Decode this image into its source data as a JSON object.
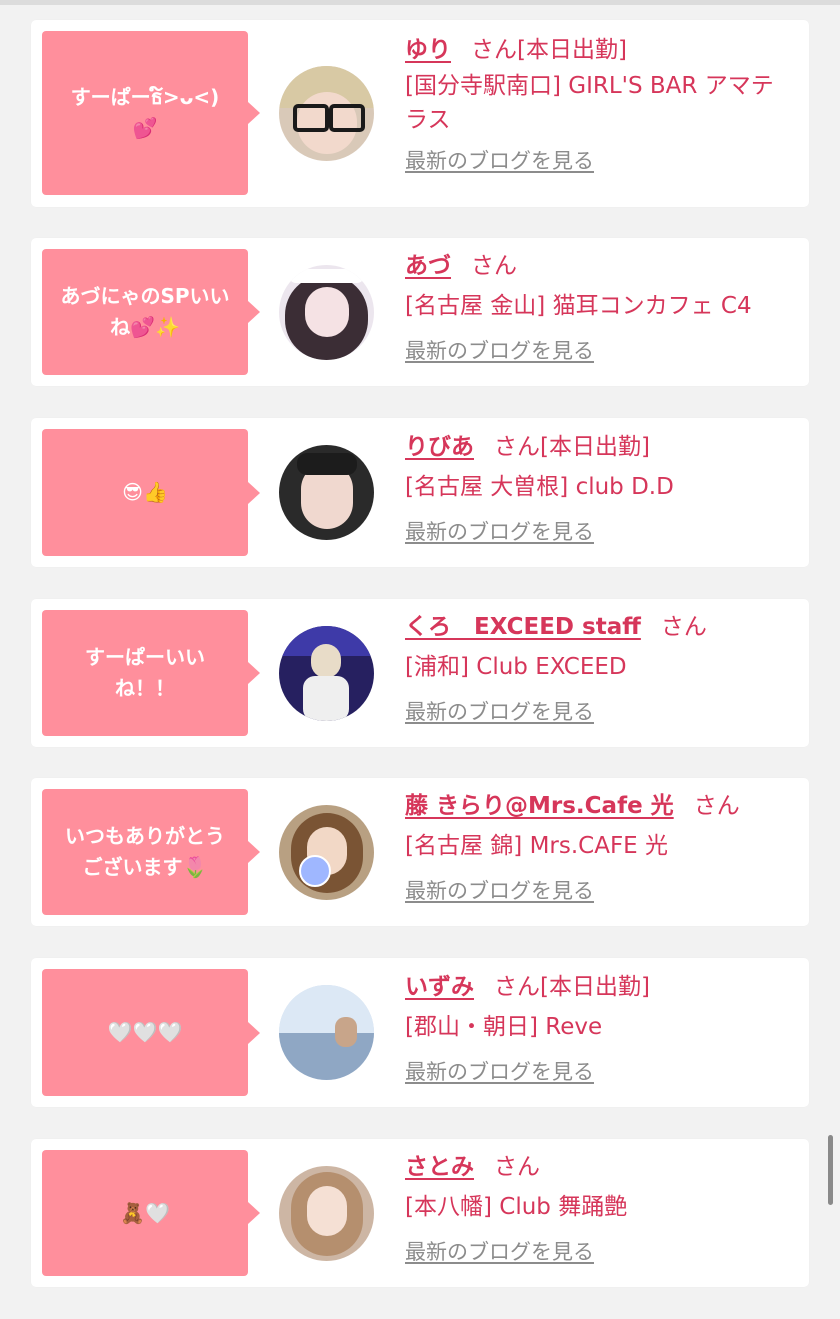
{
  "cards": [
    {
      "comment": [
        "すーぱーธ໌>ᴗ<)",
        "💕"
      ],
      "name": "ゆり",
      "honorific": "さん",
      "status": "[本日出勤]",
      "shop": "[国分寺駅南口] GIRL'S BAR アマテラス",
      "blog": "最新のブログを見る"
    },
    {
      "comment": [
        "あづにゃのSPいい",
        "ね💕✨"
      ],
      "name": "あづ",
      "honorific": "さん",
      "status": "",
      "shop": "[名古屋 金山] 猫耳コンカフェ C4",
      "blog": "最新のブログを見る"
    },
    {
      "comment": [
        "😎👍"
      ],
      "name": "りびあ",
      "honorific": "さん",
      "status": "[本日出勤]",
      "shop": "[名古屋 大曽根] club D.D",
      "blog": "最新のブログを見る"
    },
    {
      "comment": [
        "すーぱーいい",
        "ね！！"
      ],
      "name": "くろ　EXCEED staff",
      "honorific": "さん",
      "status": "",
      "shop": "[浦和] Club EXCEED",
      "blog": "最新のブログを見る"
    },
    {
      "comment": [
        "いつもありがとう",
        "ございます🌷"
      ],
      "name": "藤 きらり@Mrs.Cafe 光",
      "honorific": "さん",
      "status": "",
      "shop": "[名古屋 錦] Mrs.CAFE 光",
      "blog": "最新のブログを見る"
    },
    {
      "comment": [
        "🤍🤍🤍"
      ],
      "name": "いずみ",
      "honorific": "さん",
      "status": "[本日出勤]",
      "shop": "[郡山・朝日] Reve",
      "blog": "最新のブログを見る"
    },
    {
      "comment": [
        "🧸🤍"
      ],
      "name": "さとみ",
      "honorific": "さん",
      "status": "",
      "shop": "[本八幡] Club 舞踊艶",
      "blog": "最新のブログを見る"
    }
  ],
  "colors": {
    "accent": "#d6365a",
    "bubble": "#ff8f9c",
    "link_gray": "#8c8c8c",
    "background": "#f2f2f2"
  }
}
